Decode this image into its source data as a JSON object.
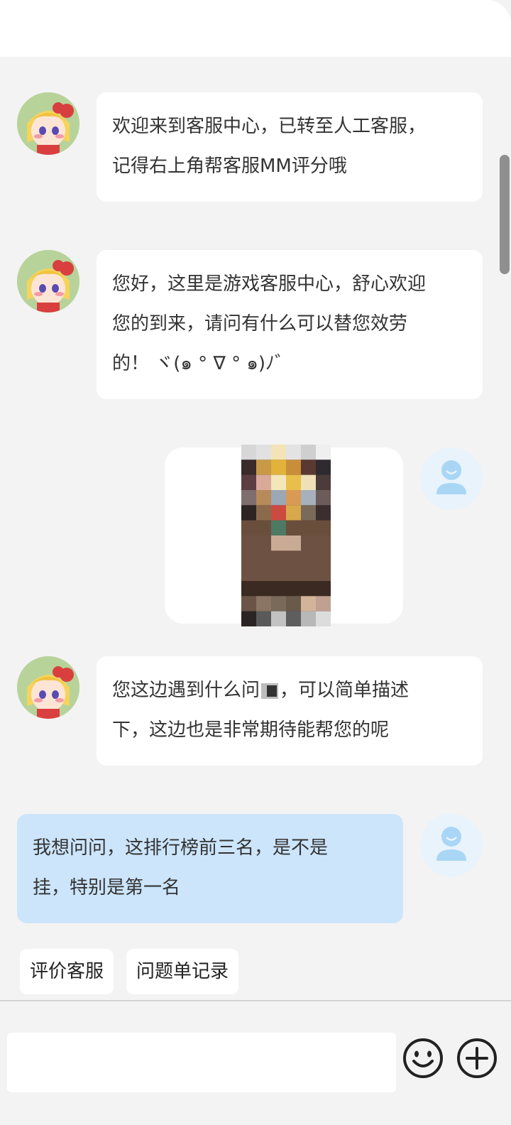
{
  "messages": {
    "m1": {
      "line1": "欢迎来到客服中心，已转至人工客服，",
      "line2": "记得右上角帮客服MM评分哦"
    },
    "m2": {
      "line1": "您好，这里是游戏客服中心，舒心欢迎",
      "line2": "您的到来，请问有什么可以替您效劳",
      "line3": "的！ ヾ(๑ ° ∇ ° ๑)ﾉ゛"
    },
    "m4": {
      "line1_a": "您这边遇到什么问",
      "line1_b": "，可以简单描述",
      "line2": "下，这边也是非常期待能帮您的呢"
    },
    "m5": {
      "line1": "我想问问，这排行榜前三名，是不是",
      "line2": "挂，特别是第一名"
    }
  },
  "quick_actions": {
    "rate": "评价客服",
    "tickets": "问题单记录"
  },
  "composer": {
    "value": "",
    "placeholder": ""
  },
  "colors": {
    "background": "#f3f3f3",
    "agent_bubble": "#ffffff",
    "user_bubble": "#cce5fb",
    "user_avatar": "#a9d6f5"
  }
}
